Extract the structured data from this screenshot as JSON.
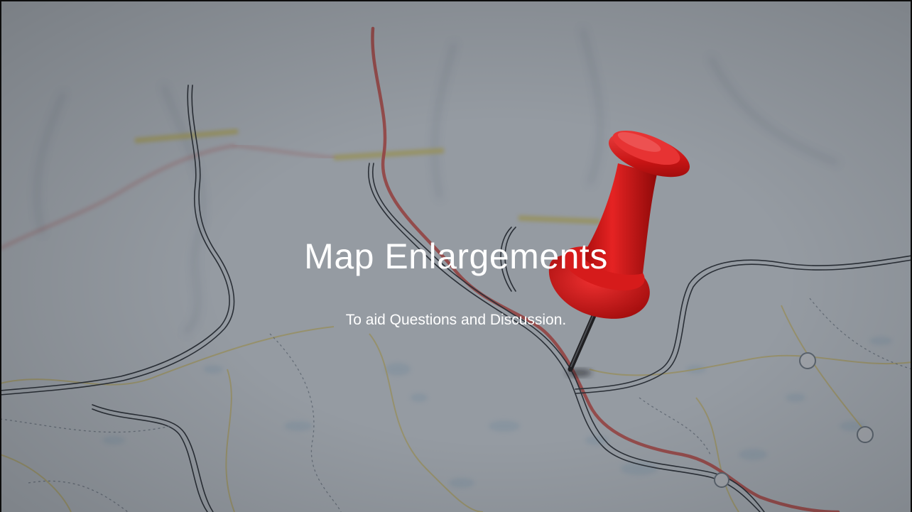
{
  "slide": {
    "title": "Map Enlargements",
    "subtitle": "To aid Questions and Discussion."
  },
  "background": {
    "image_subject": "map-with-push-pin-icon",
    "map_paper_color": "#dfe4ea",
    "overlay_color": "#28303a",
    "road_red_color": "#e0524a",
    "road_yellow_color": "#e8d66a",
    "pin_color": "#e11d1d"
  }
}
